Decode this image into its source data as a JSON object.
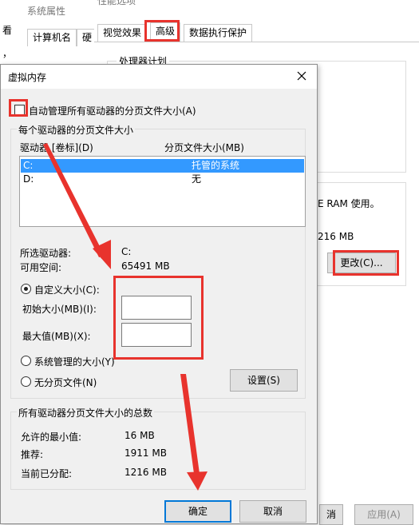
{
  "bg_window_sys": {
    "title": "系统属性",
    "tabs": [
      "计算机名",
      "硬"
    ],
    "side_chars": [
      "看",
      "，"
    ]
  },
  "bg_window_perf": {
    "title": "性能选项",
    "tabs": [
      "视觉效果",
      "高级",
      "数据执行保护"
    ],
    "group_title": "处理器计划",
    "ram_text": "E RAM 使用。",
    "size_text": "216 MB",
    "change_button": "更改(C)...",
    "bottom_buttons": [
      "消",
      "应用(A)"
    ]
  },
  "dialog": {
    "title": "虚拟内存",
    "auto_manage": "自动管理所有驱动器的分页文件大小(A)",
    "per_drive_title": "每个驱动器的分页文件大小",
    "col_drive": "驱动器 [卷标](D)",
    "col_size": "分页文件大小(MB)",
    "drives": [
      {
        "drive": "C:",
        "size": "托管的系统"
      },
      {
        "drive": "D:",
        "size": "无"
      }
    ],
    "selected_drive_label": "所选驱动器:",
    "selected_drive_value": "C:",
    "free_space_label": "可用空间:",
    "free_space_value": "65491 MB",
    "custom_size": "自定义大小(C):",
    "initial_size": "初始大小(MB)(I):",
    "max_size": "最大值(MB)(X):",
    "system_managed": "系统管理的大小(Y)",
    "no_paging": "无分页文件(N)",
    "set_button": "设置(S)",
    "totals_title": "所有驱动器分页文件大小的总数",
    "min_allowed_label": "允许的最小值:",
    "min_allowed_value": "16 MB",
    "recommended_label": "推荐:",
    "recommended_value": "1911 MB",
    "current_label": "当前已分配:",
    "current_value": "1216 MB",
    "ok_button": "确定",
    "cancel_button": "取消"
  },
  "colors": {
    "annotation_red": "#e8332d",
    "selection_blue": "#3399ff",
    "default_button_border": "#0078d7"
  }
}
